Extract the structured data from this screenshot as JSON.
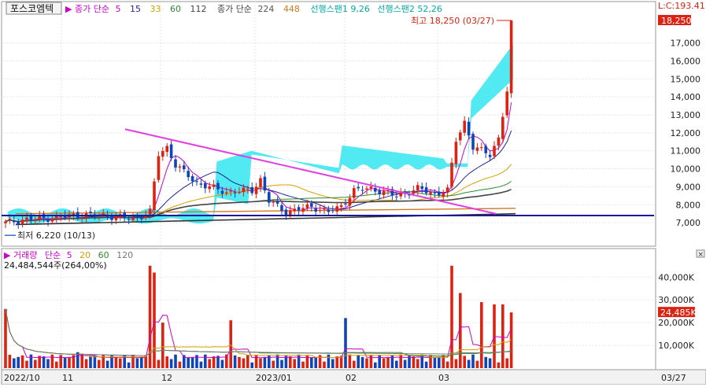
{
  "header": {
    "stock_name": "포스코엠텍",
    "ma_label": "종가 단순",
    "ma_periods": [
      "5",
      "15",
      "33",
      "60",
      "112"
    ],
    "ma_colors": [
      "#cc00cc",
      "#222299",
      "#d4a000",
      "#2e8b2e",
      "#444444"
    ],
    "ma_long_label": "종가 단순",
    "ma_long_periods": [
      "224",
      "448"
    ],
    "ma_long_colors": [
      "#555555",
      "#d07820"
    ],
    "ichimoku_1": "선행스팬1 9,26",
    "ichimoku_2": "선행스팬2 52,26",
    "ichimoku_color": "#00aaaa",
    "top_right_value": "L:C:193.41"
  },
  "price_panel": {
    "y_ticks": [
      "7,000",
      "8,000",
      "9,000",
      "10,000",
      "11,000",
      "12,000",
      "13,000",
      "14,000",
      "15,000",
      "16,000",
      "17,000"
    ],
    "current_price_badge": "18,250",
    "high_annotation": "최고 18,250 (03/27)",
    "low_annotation": "최저 6,220 (10/13)"
  },
  "volume_panel": {
    "title": "거래량",
    "ma_label": "단순",
    "ma_periods": [
      "5",
      "20",
      "60",
      "120"
    ],
    "ma_colors": [
      "#cc00cc",
      "#d4a000",
      "#2e8b2e",
      "#777777"
    ],
    "volume_text": "24,484,544주(264,00%)",
    "y_ticks": [
      "10,000K",
      "20,000K",
      "30,000K",
      "40,000K"
    ],
    "current_volume_badge": "24,485K"
  },
  "x_axis": {
    "labels": [
      "2022/10",
      "11",
      "12",
      "2023/01",
      "02",
      "03"
    ],
    "end_date": "03/27"
  },
  "colors": {
    "up": "#dd2211",
    "down": "#1144bb",
    "trendline": "#e040e0",
    "support": "#1a1a99",
    "cloud": "#33e6f0"
  },
  "chart_data": {
    "type": "candlestick",
    "price_range": [
      6000,
      18600
    ],
    "volume_range": [
      0,
      47000
    ],
    "x_categories": [
      "2022/10",
      "11",
      "12",
      "2023/01",
      "02",
      "03"
    ],
    "high": {
      "value": 18250,
      "date": "03/27"
    },
    "low": {
      "value": 6220,
      "date": "10/13"
    },
    "last_close": 18250,
    "last_volume_k": 24485
  }
}
